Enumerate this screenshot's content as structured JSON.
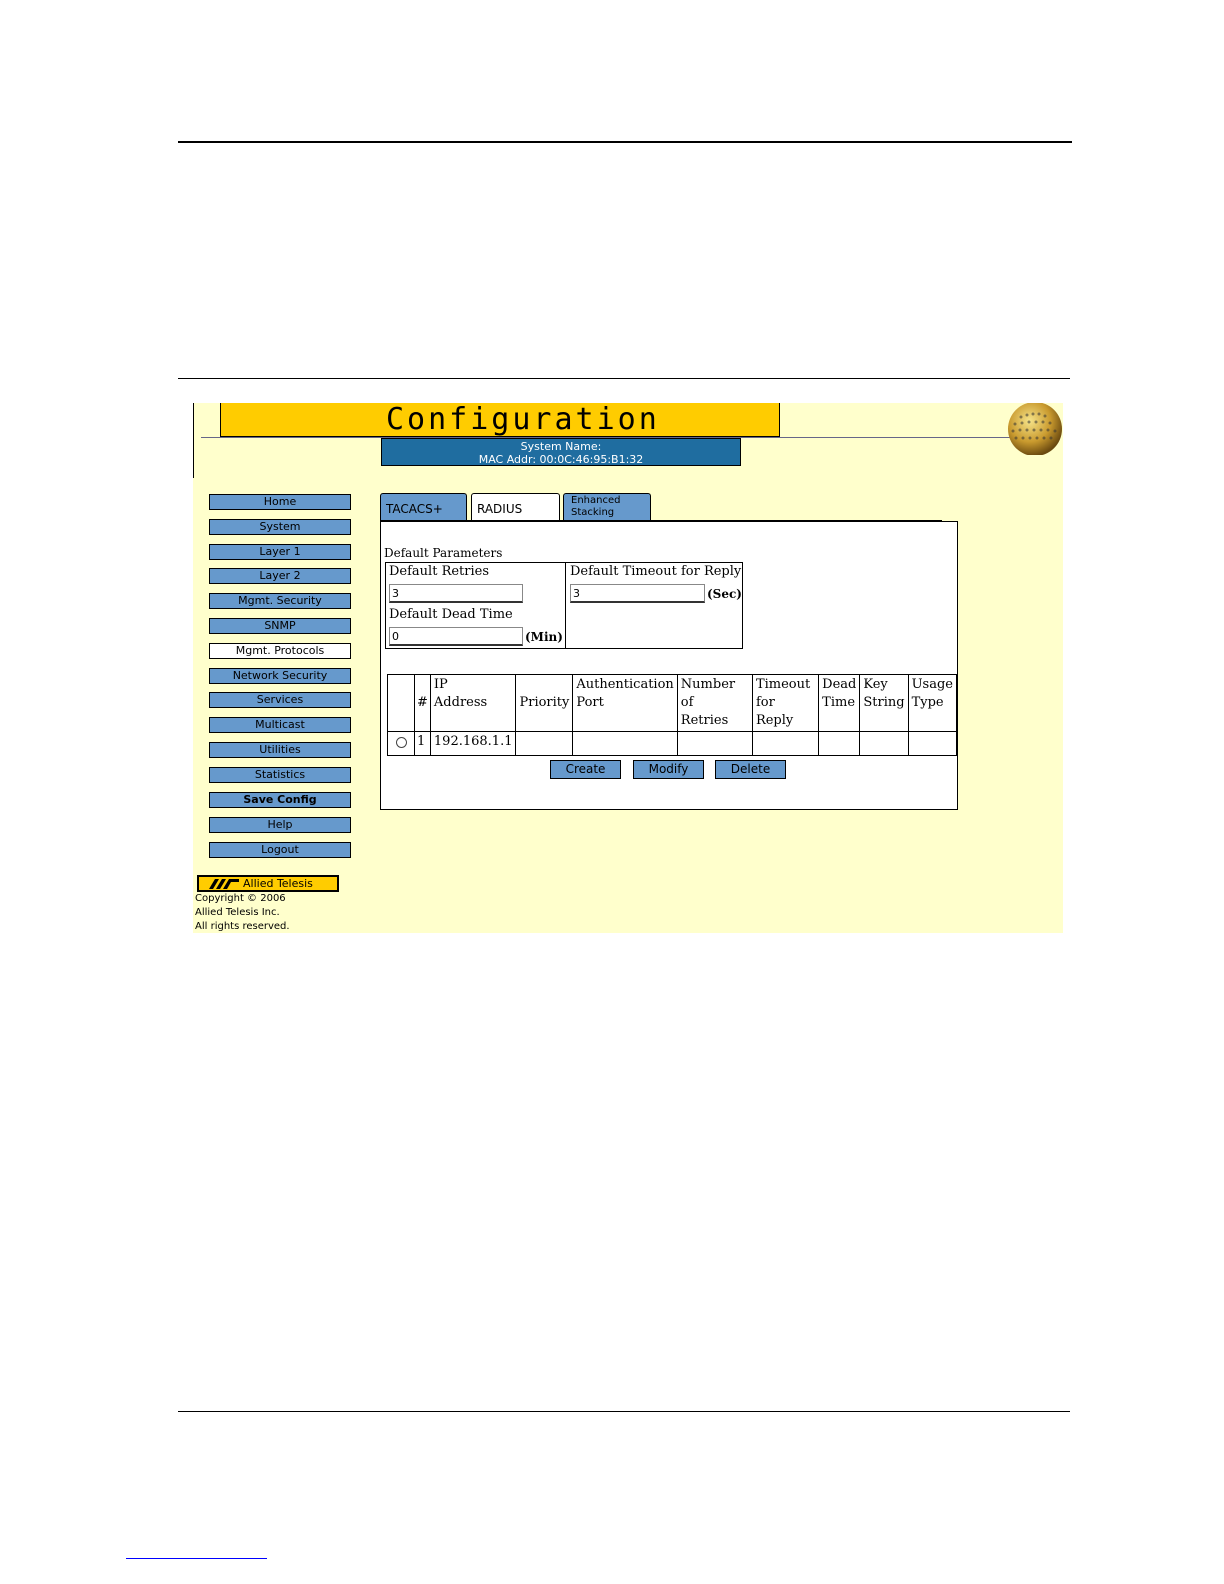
{
  "app": {
    "title": "Configuration",
    "system_name_label": "System Name:",
    "mac_addr": "MAC Addr: 00:0C:46:95:B1:32"
  },
  "sidebar": {
    "items": [
      {
        "label": "Home"
      },
      {
        "label": "System"
      },
      {
        "label": "Layer 1"
      },
      {
        "label": "Layer 2"
      },
      {
        "label": "Mgmt. Security"
      },
      {
        "label": "SNMP"
      },
      {
        "label": "Mgmt. Protocols",
        "active": true
      },
      {
        "label": "Network Security"
      },
      {
        "label": "Services"
      },
      {
        "label": "Multicast"
      },
      {
        "label": "Utilities"
      },
      {
        "label": "Statistics"
      },
      {
        "label": "Save Config"
      },
      {
        "label": "Help"
      },
      {
        "label": "Logout"
      }
    ]
  },
  "brand": {
    "logo": "Allied Telesis",
    "copyright_line1": "Copyright © 2006",
    "copyright_line2": "Allied Telesis  Inc.",
    "copyright_line3": "All rights reserved."
  },
  "tabs": [
    {
      "label": "TACACS+"
    },
    {
      "label": "RADIUS",
      "active": true
    },
    {
      "label": "Enhanced Stacking"
    }
  ],
  "tabs_stacking": {
    "line1": "Enhanced",
    "line2": "Stacking"
  },
  "defaults": {
    "title": "Default Parameters",
    "retries_label": "Default Retries",
    "retries_value": "3",
    "dead_time_label": "Default Dead Time",
    "dead_time_value": "0",
    "dead_time_unit": "(Min)",
    "timeout_label": "Default Timeout for Reply",
    "timeout_value": "3",
    "timeout_unit": "(Sec)"
  },
  "table": {
    "headers": {
      "num": "#",
      "ip_1": "IP",
      "ip_2": "Address",
      "priority": "Priority",
      "auth_1": "Authentication",
      "auth_2": "Port",
      "retries_1": "Number of",
      "retries_2": "Retries",
      "timeout_1": "Timeout",
      "timeout_2": "for Reply",
      "dead_1": "Dead",
      "dead_2": "Time",
      "key_1": "Key",
      "key_2": "String",
      "usage_1": "Usage",
      "usage_2": "Type"
    },
    "rows": [
      {
        "num": "1",
        "ip": "192.168.1.1",
        "priority": "",
        "auth_port": "",
        "retries": "",
        "timeout": "",
        "dead_time": "",
        "key": "",
        "usage": ""
      }
    ]
  },
  "actions": {
    "create": "Create",
    "modify": "Modify",
    "delete": "Delete"
  },
  "colors": {
    "page_bg": "#ffffcc",
    "title_bar": "#ffcc00",
    "info_bar": "#1f6da0",
    "button": "#6699cc"
  }
}
